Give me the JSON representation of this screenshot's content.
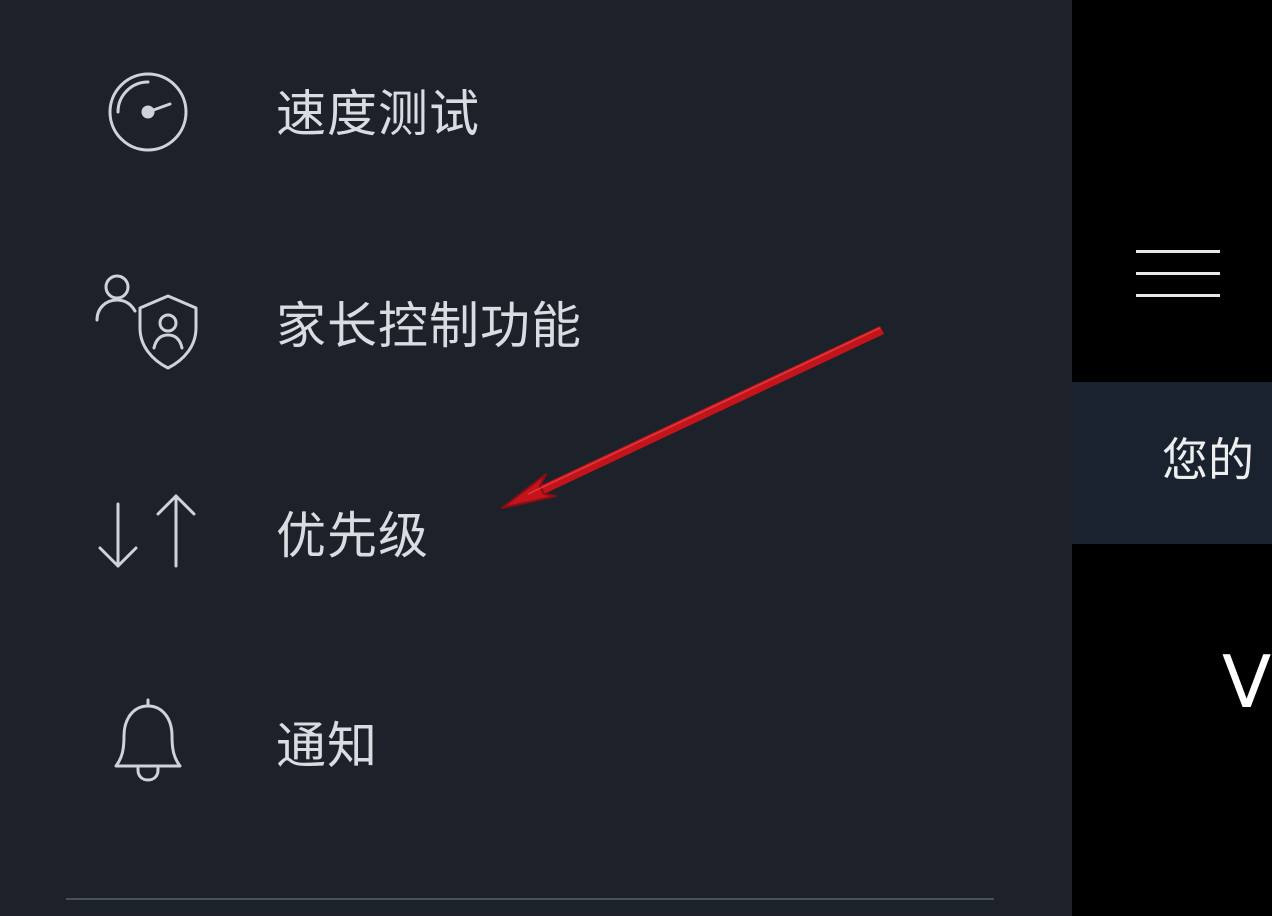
{
  "drawer": {
    "items": [
      {
        "label": "速度测试",
        "icon": "speedometer-icon"
      },
      {
        "label": "家长控制功能",
        "icon": "parental-control-icon"
      },
      {
        "label": "优先级",
        "icon": "priority-arrows-icon"
      },
      {
        "label": "通知",
        "icon": "bell-icon"
      }
    ]
  },
  "background_app": {
    "banner_text": "您的",
    "large_text": "V"
  },
  "colors": {
    "drawer_background": "#1c212a",
    "text": "#d9dce1",
    "icon_stroke": "#cfd3d9",
    "annotation": "#c4141b",
    "app_background": "#000000",
    "banner_background": "#19222e"
  }
}
